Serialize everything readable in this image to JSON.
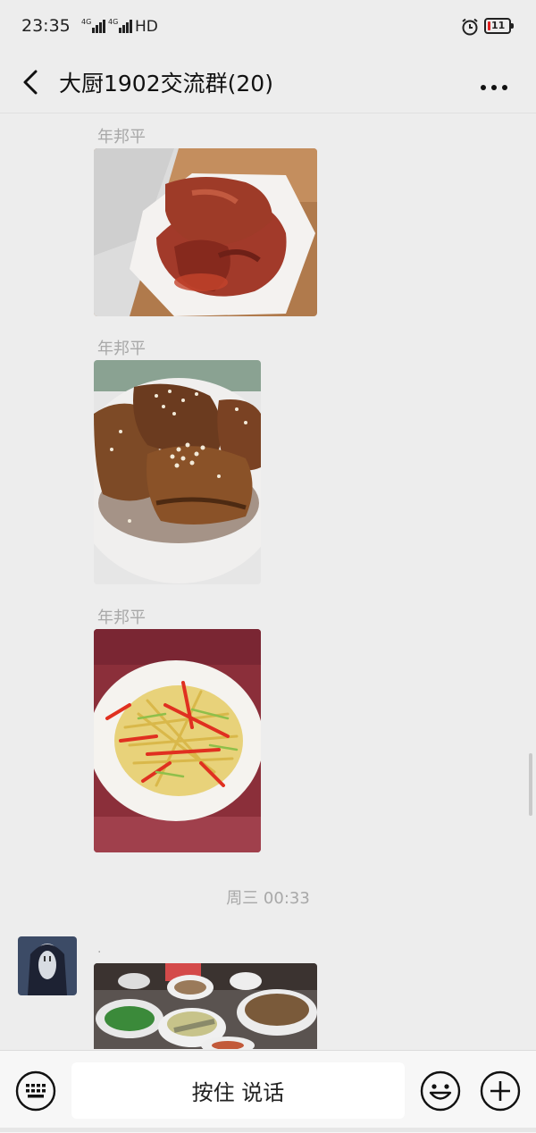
{
  "status_bar": {
    "time": "23:35",
    "net1": "4G",
    "net2": "4G",
    "hd": "HD",
    "battery": "11"
  },
  "header": {
    "title": "大厨1902交流群(20)"
  },
  "messages": [
    {
      "sender": "年邦平",
      "image": "braised pork ribs on a hexagonal white plate"
    },
    {
      "sender": "年邦平",
      "image": "pan-fried chicken wings with sesame seeds"
    },
    {
      "sender": "年邦平",
      "image": "shredded potato with red chili on a white plate"
    }
  ],
  "timestamp": "周三 00:33",
  "last_message": {
    "sender": ".",
    "image": "table with several dishes"
  },
  "input_bar": {
    "hold_to_talk": "按住 说话"
  },
  "colors": {
    "background": "#ededed",
    "sender_name": "#a8a8a8",
    "input_bar": "#f7f7f7"
  }
}
